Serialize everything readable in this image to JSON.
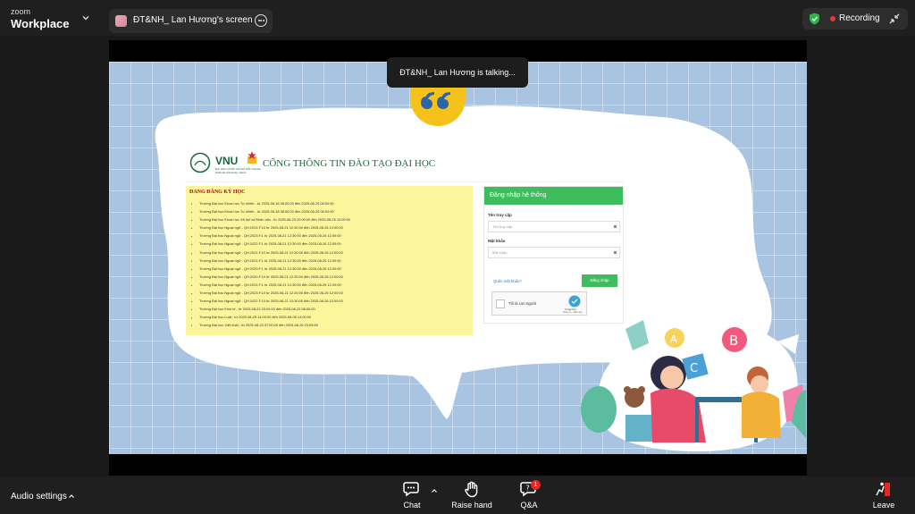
{
  "app": {
    "brand_top": "zoom",
    "brand_bottom": "Workplace"
  },
  "share_tab": {
    "title": "ĐT&NH_ Lan Hương's screen"
  },
  "recording": {
    "label": "Recording",
    "status_color": "#e53935"
  },
  "speaker": {
    "talking_label": "ĐT&NH_ Lan Hương is talking..."
  },
  "portal": {
    "logo": "VNU",
    "logo_sub": "ĐẠI HỌC QUỐC GIA HÀ NỘI Vietnam National University, Hanoi",
    "title": "CỔNG THÔNG TIN ĐÀO TẠO ĐẠI HỌC",
    "notice_heading": "ĐANG ĐĂNG KÝ HỌC",
    "notices": [
      "Trường Đại học Khoa học Tự nhiên - từ 2025-08-18 08:00:00 đến 2025-08-25 08:00:00",
      "Trường Đại học Khoa học Tự nhiên - từ 2025-08-18 08:00:00 đến 2025-08-25 08:00:00",
      "Trường Đại học Khoa học Xã hội và Nhân văn - từ 2025-08-23 20:00:00 đến 2025-08-25 10:00:00",
      "Trường Đại học Ngoại ngữ - QH.2024.F.10 từ 2025-08-21 12:30:00 đến 2025-08-26 12:00:00",
      "Trường Đại học Ngoại ngữ - QH.2023.F.1 từ 2025-08-21 12:30:00 đến 2025-08-26 12:00:00",
      "Trường Đại học Ngoại ngữ - QH.2022.F.1 từ 2025-08-21 12:30:00 đến 2025-08-26 12:00:00",
      "Trường Đại học Ngoại ngữ - QH.2021.F.10 từ 2025-08-21 12:30:00 đến 2025-08-26 12:00:00",
      "Trường Đại học Ngoại ngữ - QH.2021.F.1 từ 2025-08-21 12:30:00 đến 2025-08-26 12:00:00",
      "Trường Đại học Ngoại ngữ - QH.2020.F.1 từ 2025-08-21 12:30:00 đến 2025-08-26 12:00:00",
      "Trường Đại học Ngoại ngữ - QH.2020.F.10 từ 2025-08-21 12:30:00 đến 2025-08-26 12:00:00",
      "Trường Đại học Ngoại ngữ - QH.2024.F.1 từ 2025-08-21 12:30:00 đến 2025-08-26 12:00:00",
      "Trường Đại học Ngoại ngữ - QH.2023.F.10 từ 2025-08-21 12:30:00 đến 2025-08-26 12:00:00",
      "Trường Đại học Ngoại ngữ - QH.2022.F.10 từ 2025-08-21 12:30:00 đến 2025-08-26 12:00:00",
      "Trường Đại học Kinh tế - từ 2025-08-22 20:00:00 đến 2025-08-25 08:00:00",
      "Trường Đại học Luật - từ 2025-08-25 14:00:00 đến 2025-08-05 14:00:00",
      "Trường Đại học Việt nhật - từ 2025-08-23 07:00:00 đến 2025-08-26 23:59:59"
    ],
    "login": {
      "heading": "Đăng nhập hệ thống",
      "username_label": "Tên truy cập",
      "username_placeholder": "Tên truy cập",
      "password_label": "Mật khẩu",
      "password_placeholder": "Mật khẩu",
      "forgot": "Quên mật khẩu?",
      "submit": "Đăng nhập",
      "captcha_label": "Tôi là con người",
      "captcha_brand": "hCaptcha",
      "captcha_footer": "Riêng tư - Điều tiện"
    },
    "accent_color": "#3dbd5c"
  },
  "bottom": {
    "audio": "Audio settings",
    "chat": "Chat",
    "raise_hand": "Raise hand",
    "qa": "Q&A",
    "qa_badge": "1",
    "leave": "Leave"
  }
}
